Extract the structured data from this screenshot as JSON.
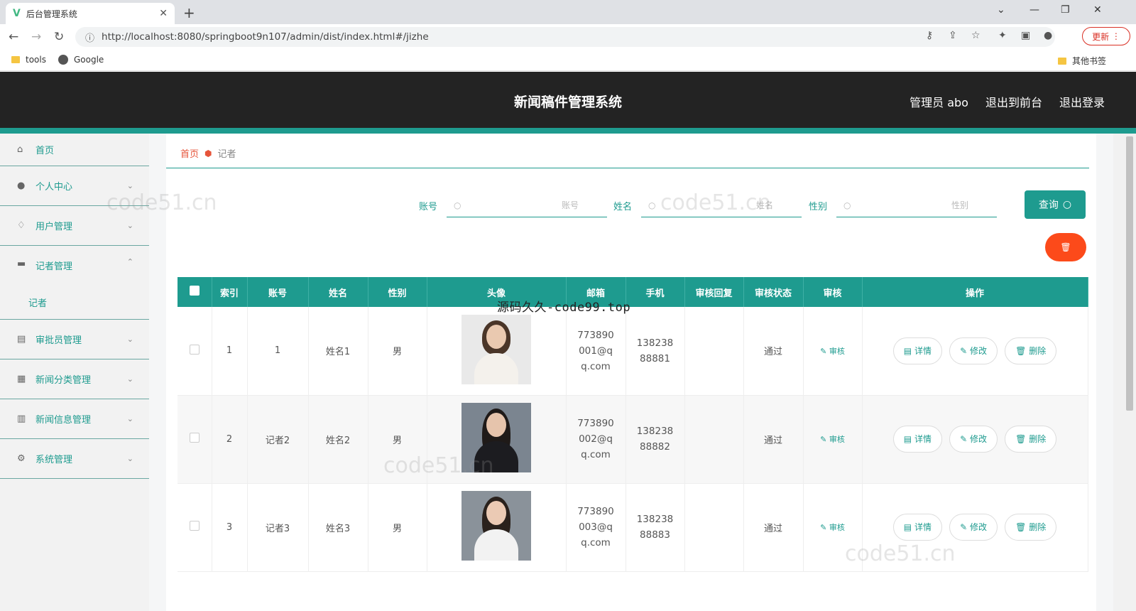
{
  "browser": {
    "tab_title": "后台管理系统",
    "url": "http://localhost:8080/springboot9n107/admin/dist/index.html#/jizhe",
    "update_label": "更新",
    "bookmarks": [
      "tools",
      "Google"
    ],
    "other_bookmarks": "其他书签"
  },
  "header": {
    "title": "新闻稿件管理系统",
    "links": [
      "管理员 abo",
      "退出到前台",
      "退出登录"
    ]
  },
  "sidebar": {
    "items": [
      {
        "label": "首页",
        "icon": "home-icon"
      },
      {
        "label": "个人中心",
        "icon": "user-icon"
      },
      {
        "label": "用户管理",
        "icon": "bell-off-icon"
      },
      {
        "label": "记者管理",
        "icon": "ticket-icon"
      },
      {
        "label": "审批员管理",
        "icon": "chart-icon"
      },
      {
        "label": "新闻分类管理",
        "icon": "grid-icon"
      },
      {
        "label": "新闻信息管理",
        "icon": "clipboard-icon"
      },
      {
        "label": "系统管理",
        "icon": "gear-icon"
      }
    ],
    "sub_item": "记者"
  },
  "breadcrumb": {
    "home": "首页",
    "current": "记者"
  },
  "search": {
    "fields": [
      {
        "label": "账号",
        "placeholder": "账号"
      },
      {
        "label": "姓名",
        "placeholder": "姓名"
      },
      {
        "label": "性别",
        "placeholder": "性别"
      }
    ],
    "query_label": "查询"
  },
  "table": {
    "headers": [
      "索引",
      "账号",
      "姓名",
      "性别",
      "头像",
      "邮箱",
      "手机",
      "审核回复",
      "审核状态",
      "审核",
      "操作"
    ],
    "rows": [
      {
        "index": "1",
        "account": "1",
        "name": "姓名1",
        "gender": "男",
        "email": "773890001@qq.com",
        "phone": "13823888881",
        "reply": "",
        "status": "通过",
        "audit": "审核"
      },
      {
        "index": "2",
        "account": "记者2",
        "name": "姓名2",
        "gender": "男",
        "email": "773890002@qq.com",
        "phone": "13823888882",
        "reply": "",
        "status": "通过",
        "audit": "审核"
      },
      {
        "index": "3",
        "account": "记者3",
        "name": "姓名3",
        "gender": "男",
        "email": "773890003@qq.com",
        "phone": "13823888883",
        "reply": "",
        "status": "通过",
        "audit": "审核"
      }
    ],
    "actions": [
      "详情",
      "修改",
      "删除"
    ]
  },
  "watermark": {
    "site": "code51.cn",
    "center": "源码久久-code99.top"
  },
  "colors": {
    "accent": "#1e9b8f",
    "header": "#232323",
    "danger": "#fc4a1a",
    "breadcrumb": "#e6543a"
  }
}
